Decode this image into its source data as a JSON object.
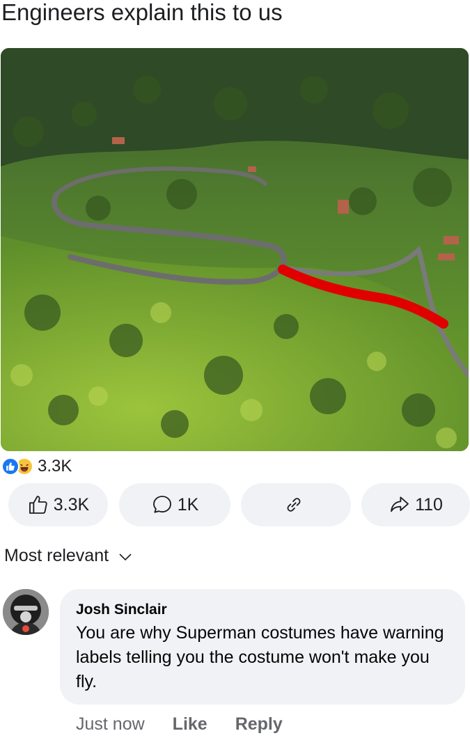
{
  "post": {
    "title": "Engineers explain this to us"
  },
  "reactions": {
    "summary_count": "3.3K",
    "icons": [
      "like-icon",
      "haha-icon"
    ]
  },
  "actions": {
    "like_count": "3.3K",
    "comment_count": "1K",
    "share_count": "110",
    "icons": [
      "thumbs-up-icon",
      "comment-icon",
      "link-icon",
      "share-icon"
    ]
  },
  "comments_sort": {
    "label": "Most relevant"
  },
  "comment": {
    "author": "Josh Sinclair",
    "text": "You are why Superman costumes have warning labels telling you the costume won't make you fly.",
    "time": "Just now",
    "like_label": "Like",
    "reply_label": "Reply"
  },
  "colors": {
    "accent": "#1877f2",
    "button_bg": "#f0f2f5",
    "meta_text": "#65676b",
    "road_marking": "#e00000"
  }
}
